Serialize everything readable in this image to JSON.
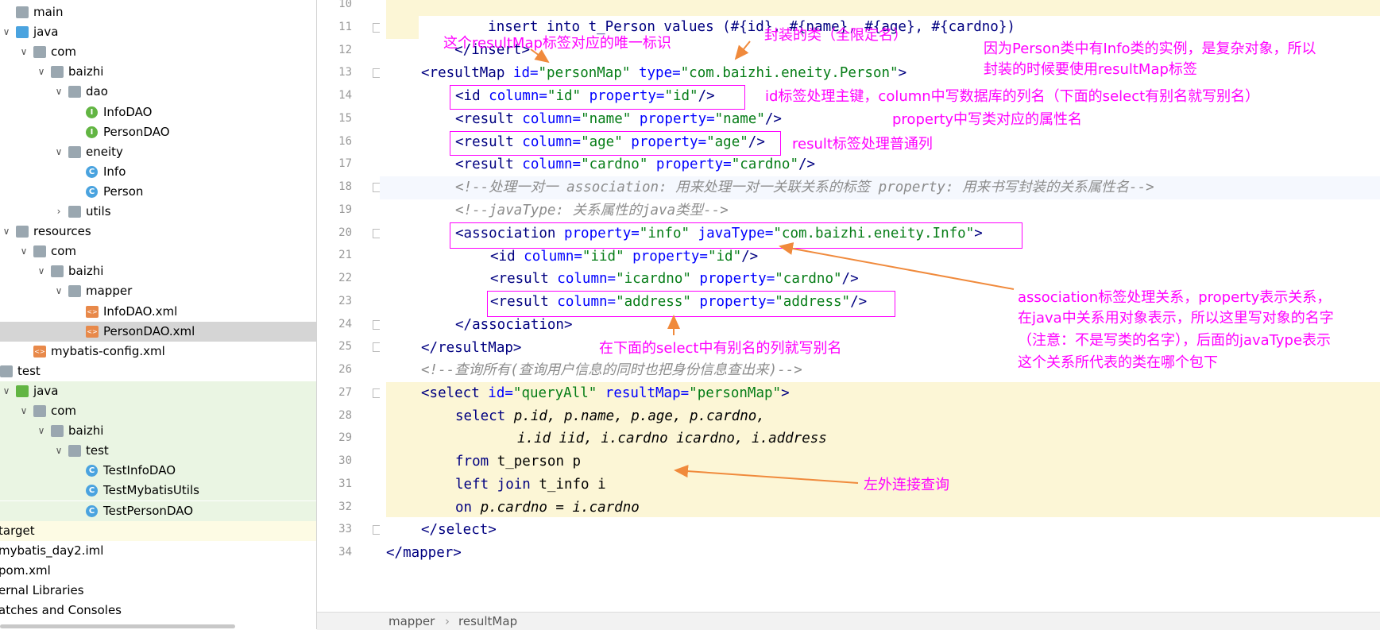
{
  "project_tree": [
    {
      "label": "main",
      "icon": "folder-icon",
      "depth": 0,
      "arrow": ""
    },
    {
      "label": "java",
      "icon": "source-folder-icon",
      "depth": 0,
      "arrow": "∨"
    },
    {
      "label": "com",
      "icon": "package-icon",
      "depth": 1,
      "arrow": "∨"
    },
    {
      "label": "baizhi",
      "icon": "package-icon",
      "depth": 2,
      "arrow": "∨"
    },
    {
      "label": "dao",
      "icon": "package-icon",
      "depth": 3,
      "arrow": "∨"
    },
    {
      "label": "InfoDAO",
      "icon": "interface-icon",
      "depth": 4,
      "arrow": ""
    },
    {
      "label": "PersonDAO",
      "icon": "interface-icon",
      "depth": 4,
      "arrow": ""
    },
    {
      "label": "eneity",
      "icon": "package-icon",
      "depth": 3,
      "arrow": "∨"
    },
    {
      "label": "Info",
      "icon": "class-icon",
      "depth": 4,
      "arrow": ""
    },
    {
      "label": "Person",
      "icon": "class-icon",
      "depth": 4,
      "arrow": ""
    },
    {
      "label": "utils",
      "icon": "package-icon",
      "depth": 3,
      "arrow": "›"
    },
    {
      "label": "resources",
      "icon": "resources-folder-icon",
      "depth": 0,
      "arrow": "∨"
    },
    {
      "label": "com",
      "icon": "package-icon",
      "depth": 1,
      "arrow": "∨"
    },
    {
      "label": "baizhi",
      "icon": "package-icon",
      "depth": 2,
      "arrow": "∨"
    },
    {
      "label": "mapper",
      "icon": "package-icon",
      "depth": 3,
      "arrow": "∨"
    },
    {
      "label": "InfoDAO.xml",
      "icon": "xml-file-icon",
      "depth": 4,
      "arrow": ""
    },
    {
      "label": "PersonDAO.xml",
      "icon": "xml-file-icon",
      "depth": 4,
      "arrow": "",
      "selected": true
    },
    {
      "label": "mybatis-config.xml",
      "icon": "xml-file-icon",
      "depth": 1,
      "arrow": ""
    },
    {
      "label": "test",
      "icon": "folder-icon",
      "depth": -1,
      "arrow": ""
    },
    {
      "label": "java",
      "icon": "test-folder-icon",
      "depth": 0,
      "arrow": "∨",
      "green": true
    },
    {
      "label": "com",
      "icon": "package-icon",
      "depth": 1,
      "arrow": "∨",
      "green": true
    },
    {
      "label": "baizhi",
      "icon": "package-icon",
      "depth": 2,
      "arrow": "∨",
      "green": true
    },
    {
      "label": "test",
      "icon": "package-icon",
      "depth": 3,
      "arrow": "∨",
      "green": true
    },
    {
      "label": "TestInfoDAO",
      "icon": "test-class-icon",
      "depth": 4,
      "arrow": "",
      "green": true
    },
    {
      "label": "TestMybatisUtils",
      "icon": "test-class-icon",
      "depth": 4,
      "arrow": "",
      "green": true
    },
    {
      "label": "TestPersonDAO",
      "icon": "test-class-icon",
      "depth": 4,
      "arrow": "",
      "green": true
    },
    {
      "label": "target",
      "icon": "",
      "depth": -2,
      "arrow": "",
      "yellow": true
    },
    {
      "label": "mybatis_day2.iml",
      "icon": "",
      "depth": -2,
      "arrow": ""
    },
    {
      "label": "pom.xml",
      "icon": "",
      "depth": -2,
      "arrow": ""
    },
    {
      "label": "ernal Libraries",
      "icon": "",
      "depth": -2,
      "arrow": ""
    },
    {
      "label": "atches and Consoles",
      "icon": "",
      "depth": -2,
      "arrow": ""
    }
  ],
  "line_numbers": [
    "10",
    "11",
    "12",
    "13",
    "14",
    "15",
    "16",
    "17",
    "18",
    "19",
    "20",
    "21",
    "22",
    "23",
    "24",
    "25",
    "26",
    "27",
    "28",
    "29",
    "30",
    "31",
    "32",
    "33",
    "34"
  ],
  "code": {
    "l10": "insert into t_Person values (#{id}, #{name}, #{age}, #{cardno})",
    "l11": "</insert>",
    "l13_tag": "<resultMap ",
    "l13_a1": "id=",
    "l13_v1": "\"personMap\"",
    "l13_a2": " type=",
    "l13_v2": "\"com.baizhi.eneity.Person\"",
    "l13_end": ">",
    "l14_tag": "<id ",
    "l14_a1": "column=",
    "l14_v1": "\"id\"",
    "l14_a2": " property=",
    "l14_v2": "\"id\"",
    "l14_end": "/>",
    "l15_tag": "<result ",
    "l15_a1": "column=",
    "l15_v1": "\"name\"",
    "l15_a2": " property=",
    "l15_v2": "\"name\"",
    "l15_end": "/>",
    "l16_tag": "<result ",
    "l16_a1": "column=",
    "l16_v1": "\"age\"",
    "l16_a2": " property=",
    "l16_v2": "\"age\"",
    "l16_end": "/>",
    "l17_tag": "<result ",
    "l17_a1": "column=",
    "l17_v1": "\"cardno\"",
    "l17_a2": " property=",
    "l17_v2": "\"cardno\"",
    "l17_end": "/>",
    "l18": "<!--处理一对一 association: 用来处理一对一关联关系的标签 property: 用来书写封装的关系属性名-->",
    "l19": "<!--javaType: 关系属性的java类型-->",
    "l20_tag": "<association ",
    "l20_a1": "property=",
    "l20_v1": "\"info\"",
    "l20_a2": " javaType=",
    "l20_v2": "\"com.baizhi.eneity.Info\"",
    "l20_end": ">",
    "l21_tag": "<id ",
    "l21_a1": "column=",
    "l21_v1": "\"iid\"",
    "l21_a2": " property=",
    "l21_v2": "\"id\"",
    "l21_end": "/>",
    "l22_tag": "<result ",
    "l22_a1": "column=",
    "l22_v1": "\"icardno\"",
    "l22_a2": " property=",
    "l22_v2": "\"cardno\"",
    "l22_end": "/>",
    "l23_tag": "<result ",
    "l23_a1": "column=",
    "l23_v1": "\"address\"",
    "l23_a2": " property=",
    "l23_v2": "\"address\"",
    "l23_end": "/>",
    "l24": "</association>",
    "l25": "</resultMap>",
    "l26": "<!--查询所有(查询用户信息的同时也把身份信息查出来)-->",
    "l27_tag": "<select ",
    "l27_a1": "id=",
    "l27_v1": "\"queryAll\"",
    "l27_a2": " resultMap=",
    "l27_v2": "\"personMap\"",
    "l27_end": ">",
    "l28_k": "select ",
    "l28_rest": "p.id, p.name, p.age, p.cardno,",
    "l29": "i.id iid, i.cardno icardno, i.address",
    "l30_k": "from ",
    "l30_rest": "t_person p",
    "l31_k": "left join ",
    "l31_rest": "t_info i",
    "l32_k": "on ",
    "l32_rest": "p.cardno = i.cardno",
    "l33": "</select>",
    "l34": "</mapper>"
  },
  "annotations": {
    "a1": "这个resultMap标签对应的唯一标识",
    "a2": "封装的类（全限定名）",
    "a3a": "因为Person类中有Info类的实例，是复杂对象，所以",
    "a3b": "封装的时候要使用resultMap标签",
    "a4a": "id标签处理主键，column中写数据库的列名（下面的select有别名就写别名）",
    "a4b": "property中写类对应的属性名",
    "a5": "result标签处理普通列",
    "a6a": "association标签处理关系，property表示关系，",
    "a6b": "在java中关系用对象表示，所以这里写对象的名字",
    "a6c": "（注意：不是写类的名字），后面的javaType表示",
    "a6d": "这个关系所代表的类在哪个包下",
    "a7": "在下面的select中有别名的列就写别名",
    "a8": "左外连接查询"
  },
  "breadcrumb": [
    "mapper",
    "resultMap"
  ],
  "colors": {
    "annotation": "#ff00ff",
    "arrow": "#f08a3c",
    "tag": "#000080",
    "attr": "#0000ff",
    "value": "#067d17",
    "comment": "#8c8c8c",
    "highlight": "#fcf6d6",
    "tree_selected": "#d5d5d5",
    "tree_test": "#eaf5e3"
  }
}
